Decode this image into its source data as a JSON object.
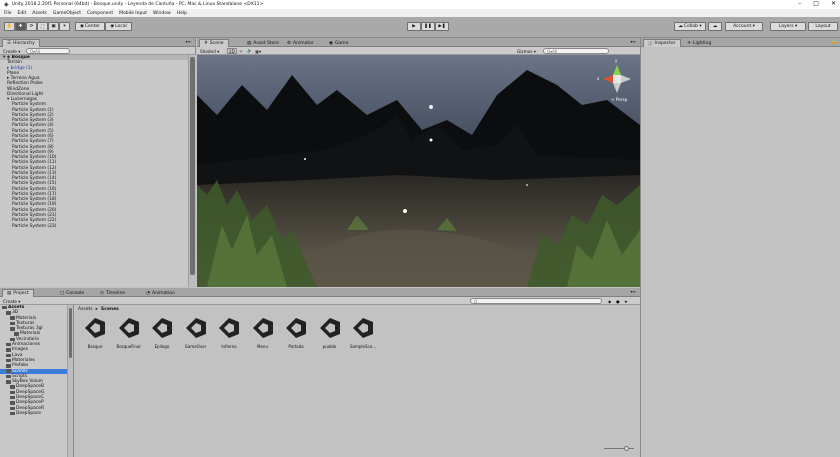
{
  "window": {
    "title": "Unity 2018.2.20f1 Personal (64bit) - Bosque.unity - Leyenda de Cantuña - PC, Mac & Linux Standalone <DX11>",
    "controls": [
      "–",
      "□",
      "✕"
    ]
  },
  "menu": [
    "File",
    "Edit",
    "Assets",
    "GameObject",
    "Component",
    "Mobile Input",
    "Window",
    "Help"
  ],
  "toolbar": {
    "pivot_label": "Center",
    "space_label": "Local",
    "collab_label": "Collab ▾",
    "account_label": "Account ▾",
    "layers_label": "Layers ▾",
    "layout_label": "Layout"
  },
  "hierarchy": {
    "tab": "Hierarchy",
    "create": "Create ▾",
    "search_placeholder": "Q▾All",
    "scene": "Bosque",
    "items": [
      {
        "t": "Terrain",
        "indent": 1,
        "arrow": false
      },
      {
        "t": "bridge (1)",
        "indent": 1,
        "arrow": true,
        "blue": true
      },
      {
        "t": "Plane",
        "indent": 1,
        "arrow": false
      },
      {
        "t": "Terreno Agua",
        "indent": 1,
        "arrow": true
      },
      {
        "t": "Reflection Probe",
        "indent": 1,
        "arrow": false
      },
      {
        "t": "WindZone",
        "indent": 1,
        "arrow": false
      },
      {
        "t": "Directional Light",
        "indent": 1,
        "arrow": false
      },
      {
        "t": "Luciernagas",
        "indent": 1,
        "arrow": true,
        "open": true
      },
      {
        "t": "Particle System",
        "indent": 2
      },
      {
        "t": "Particle System (1)",
        "indent": 2
      },
      {
        "t": "Particle System (2)",
        "indent": 2
      },
      {
        "t": "Particle System (3)",
        "indent": 2
      },
      {
        "t": "Particle System (4)",
        "indent": 2
      },
      {
        "t": "Particle System (5)",
        "indent": 2
      },
      {
        "t": "Particle System (6)",
        "indent": 2
      },
      {
        "t": "Particle System (7)",
        "indent": 2
      },
      {
        "t": "Particle System (8)",
        "indent": 2
      },
      {
        "t": "Particle System (9)",
        "indent": 2
      },
      {
        "t": "Particle System (10)",
        "indent": 2
      },
      {
        "t": "Particle System (11)",
        "indent": 2
      },
      {
        "t": "Particle System (12)",
        "indent": 2
      },
      {
        "t": "Particle System (13)",
        "indent": 2
      },
      {
        "t": "Particle System (14)",
        "indent": 2
      },
      {
        "t": "Particle System (15)",
        "indent": 2
      },
      {
        "t": "Particle System (16)",
        "indent": 2
      },
      {
        "t": "Particle System (17)",
        "indent": 2
      },
      {
        "t": "Particle System (18)",
        "indent": 2
      },
      {
        "t": "Particle System (19)",
        "indent": 2
      },
      {
        "t": "Particle System (20)",
        "indent": 2
      },
      {
        "t": "Particle System (21)",
        "indent": 2
      },
      {
        "t": "Particle System (22)",
        "indent": 2
      },
      {
        "t": "Particle System (23)",
        "indent": 2
      }
    ]
  },
  "scene_view": {
    "tabs": [
      "Scene",
      "Asset Store",
      "Animator",
      "Game"
    ],
    "shading": "Shaded",
    "mode_2d": "2D",
    "gizmos": "Gizmos ▾",
    "search_placeholder": "Q▾All",
    "persp": "< Persp",
    "axis_y": "y",
    "axis_x": "x"
  },
  "inspector": {
    "tabs": [
      "Inspector",
      "Lighting"
    ]
  },
  "project": {
    "tabs": [
      "Project",
      "Console",
      "Timeline",
      "Animation"
    ],
    "create": "Create ▾",
    "breadcrumb": [
      "Assets",
      "Scenes"
    ],
    "tree": [
      {
        "t": "Assets",
        "d": 0,
        "bold": true
      },
      {
        "t": "3D",
        "d": 1
      },
      {
        "t": "Materials",
        "d": 2
      },
      {
        "t": "Texturas",
        "d": 2
      },
      {
        "t": "Texturas 3gl",
        "d": 2
      },
      {
        "t": "Materials",
        "d": 3
      },
      {
        "t": "Vecindario",
        "d": 2
      },
      {
        "t": "Animaciones",
        "d": 1
      },
      {
        "t": "Images",
        "d": 1
      },
      {
        "t": "Lava",
        "d": 1
      },
      {
        "t": "Materiales",
        "d": 1
      },
      {
        "t": "Prefabs",
        "d": 1
      },
      {
        "t": "Scenes",
        "d": 1,
        "selected": true
      },
      {
        "t": "Scripts",
        "d": 1
      },
      {
        "t": "SkyBox Volum",
        "d": 1
      },
      {
        "t": "DeepSpaceB",
        "d": 2
      },
      {
        "t": "DeepSpaceG",
        "d": 2
      },
      {
        "t": "DeepSpaceC",
        "d": 2
      },
      {
        "t": "DeepSpaceP",
        "d": 2
      },
      {
        "t": "DeepSpaceR",
        "d": 2
      },
      {
        "t": "DeepSpace",
        "d": 2
      }
    ],
    "assets": [
      "Bosque",
      "BosqueFinal",
      "Epilogo",
      "GameOver",
      "Infierno",
      "Menu",
      "Portada",
      "pueblo",
      "SampleSce..."
    ]
  },
  "colors": {
    "accent_selection": "#3d7bd9",
    "panel_bg": "#c2c2c2",
    "unity_icon": "#222222"
  }
}
